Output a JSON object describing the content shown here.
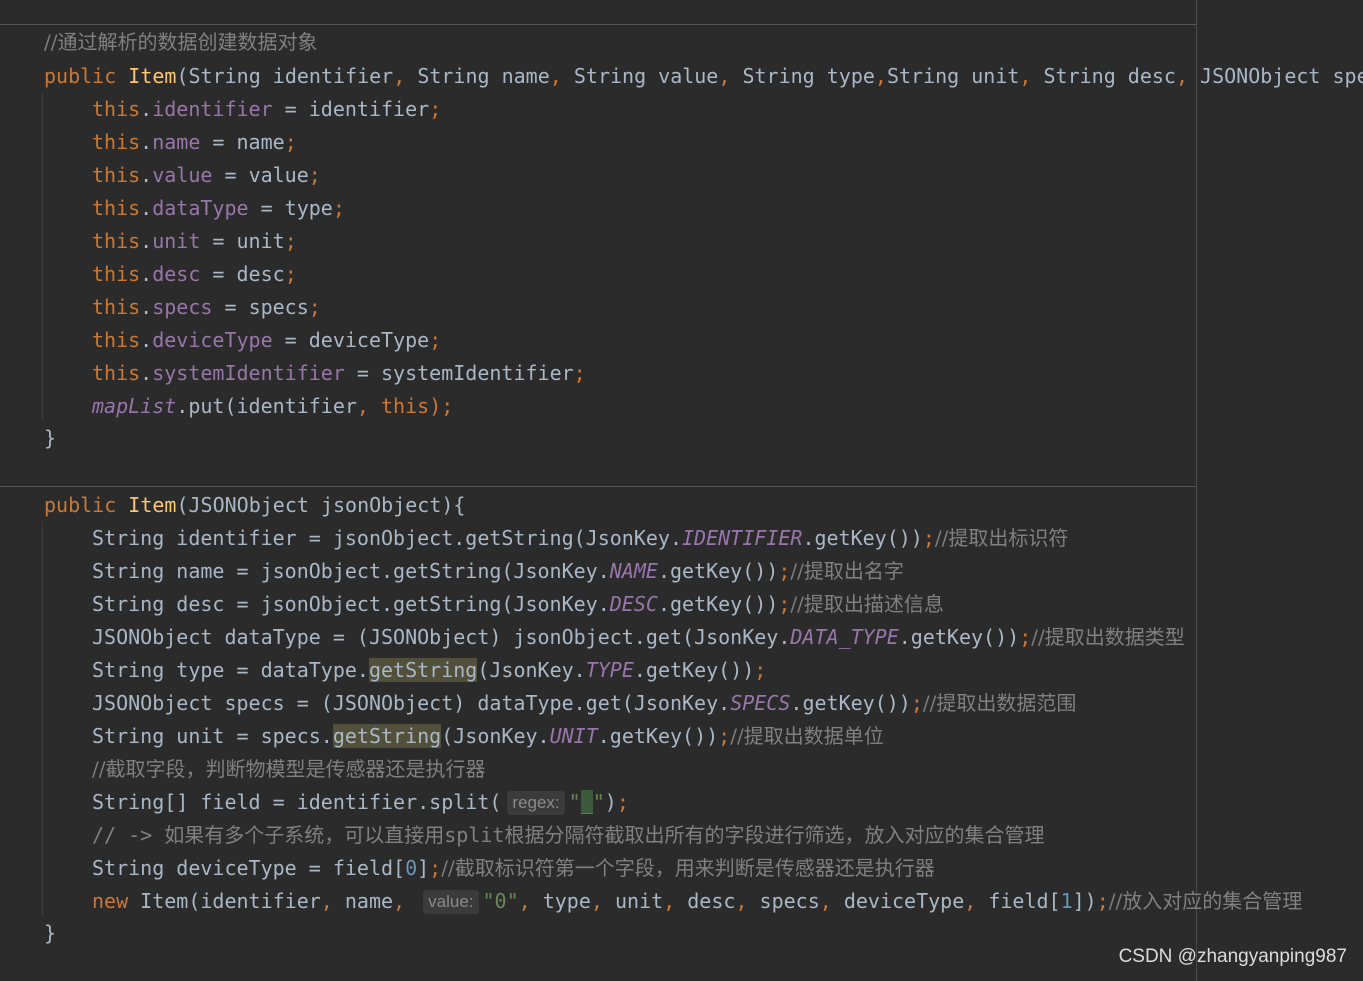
{
  "c1": {
    "comment": "//通过解析的数据创建数据对象",
    "sig": {
      "kw": "public",
      "name": "Item",
      "p1": "(String identifier",
      "p2": "String name",
      "p3": "String value",
      "p4": "String type",
      "p5": "String unit",
      "p6": "String desc",
      "p7": "JSONObject spe"
    },
    "sep_comma": ",",
    "this_kw": "this",
    "assignments": [
      {
        "field": "identifier",
        "value": "identifier"
      },
      {
        "field": "name",
        "value": "name"
      },
      {
        "field": "value",
        "value": "value"
      },
      {
        "field": "dataType",
        "value": "type"
      },
      {
        "field": "unit",
        "value": "unit"
      },
      {
        "field": "desc",
        "value": "desc"
      },
      {
        "field": "specs",
        "value": "specs"
      },
      {
        "field": "deviceType",
        "value": "deviceType"
      },
      {
        "field": "systemIdentifier",
        "value": "systemIdentifier"
      }
    ],
    "maplist": {
      "obj": "mapList",
      "call": ".put(identifier",
      "this_kw": "this",
      "end": ");"
    },
    "close": "}"
  },
  "c2": {
    "sig": {
      "kw": "public",
      "name": "Item",
      "params": "(JSONObject jsonObject){"
    },
    "l1": {
      "a": "String identifier = jsonObject.getString(JsonKey.",
      "k": "IDENTIFIER",
      "b": ".getKey())",
      "c": "//提取出标识符"
    },
    "l2": {
      "a": "String name = jsonObject.getString(JsonKey.",
      "k": "NAME",
      "b": ".getKey())",
      "c": "//提取出名字"
    },
    "l3": {
      "a": "String desc = jsonObject.getString(JsonKey.",
      "k": "DESC",
      "b": ".getKey())",
      "c": "//提取出描述信息"
    },
    "l4": {
      "a": "JSONObject dataType = (JSONObject) jsonObject.get(JsonKey.",
      "k": "DATA_TYPE",
      "b": ".getKey())",
      "c": "//提取出数据类型"
    },
    "l5": {
      "a": "String type = dataType.",
      "m": "getString",
      "b": "(JsonKey.",
      "k": "TYPE",
      "d": ".getKey())"
    },
    "l6": {
      "a": "JSONObject specs = (JSONObject) dataType.get(JsonKey.",
      "k": "SPECS",
      "b": ".getKey())",
      "c": "//提取出数据范围"
    },
    "l7": {
      "a": "String unit = specs.",
      "m": "getString",
      "b": "(JsonKey.",
      "k": "UNIT",
      "d": ".getKey())",
      "c": "//提取出数据单位"
    },
    "l8": {
      "c": "//截取字段，判断物模型是传感器还是执行器"
    },
    "l9": {
      "a": "String[] field = identifier.split(",
      "hint": "regex:",
      "q1": "\"",
      "ch": "_",
      "q2": "\"",
      "e": ")"
    },
    "l10": {
      "c1": "// -> ",
      "c2": "如果有多个子系统，可以直接用",
      "c3": "split",
      "c4": "根据分隔符截取出所有的字段进行筛选，放入对应的集合管理"
    },
    "l11": {
      "a": "String deviceType = field[",
      "n": "0",
      "b": "]",
      "c": "//截取标识符第一个字段，用来判断是传感器还是执行器"
    },
    "l12": {
      "kw": "new",
      "a": " Item(identifier",
      "b": " name",
      "hint": "value:",
      "s": "\"0\"",
      "rest": [
        " type",
        " unit",
        " desc",
        " specs",
        " deviceType",
        " field["
      ],
      "n": "1",
      "e": "])",
      "c": "//放入对应的集合管理"
    },
    "close": "}"
  },
  "semi": ";",
  "watermark": "CSDN @zhangyanping987"
}
